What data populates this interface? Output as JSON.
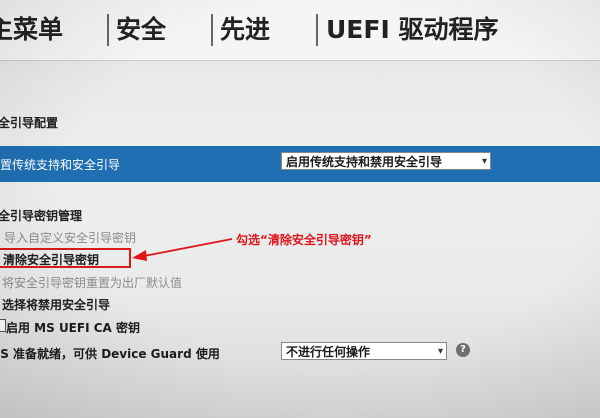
{
  "menu": {
    "tabs": [
      {
        "label": "主菜单"
      },
      {
        "label": "安全"
      },
      {
        "label": "先进"
      },
      {
        "label": "UEFI 驱动程序"
      }
    ]
  },
  "secure_boot_config": {
    "title": "全引导配置",
    "legacy_row_label": "置传统支持和安全引导",
    "legacy_select_value": "启用传统支持和禁用安全引导"
  },
  "key_management": {
    "title": "全引导密钥管理",
    "import_custom": "导入自定义安全引导密钥",
    "clear_keys": "清除安全引导密钥",
    "reset_factory": "将安全引导密钥重置为出厂默认值"
  },
  "disable_section": {
    "title": "选择将禁用安全引导",
    "ms_uefi_ca": "启用 MS UEFI CA 密钥"
  },
  "device_guard": {
    "label": "OS 准备就绪，可供 Device Guard 使用",
    "select_value": "不进行任何操作",
    "help_symbol": "?"
  },
  "annotation": {
    "text": "勾选“清除安全引导密钥”",
    "color": "#e0141b"
  },
  "colors": {
    "selection_band": "#1f6fb2",
    "highlight_box": "#d81b1b"
  }
}
